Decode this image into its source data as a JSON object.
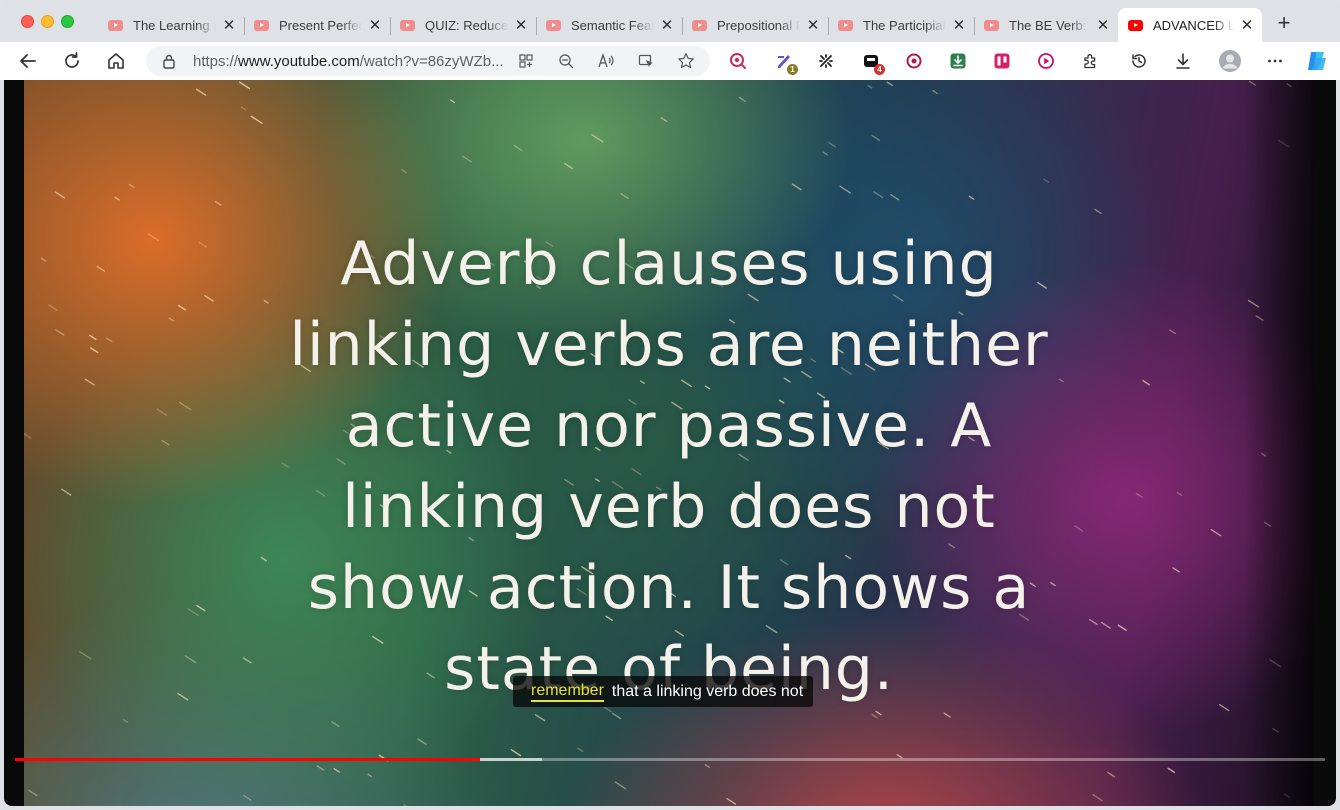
{
  "browser": {
    "tabs": [
      {
        "title": "The Learning English",
        "active": false
      },
      {
        "title": "Present Perfect",
        "active": false
      },
      {
        "title": "QUIZ: Reduced",
        "active": false
      },
      {
        "title": "Semantic Features",
        "active": false
      },
      {
        "title": "Prepositional Phrases",
        "active": false
      },
      {
        "title": "The Participial",
        "active": false
      },
      {
        "title": "The BE Verb: Is",
        "active": false
      },
      {
        "title": "ADVANCED LEVEL",
        "active": true
      }
    ],
    "tab_close_glyph": "✕",
    "new_tab_glyph": "+",
    "address": {
      "scheme": "https://",
      "domain": "www.youtube.com",
      "path": "/watch?v=86zyWZb..."
    },
    "extension_badges": {
      "first": "1",
      "second": "4"
    }
  },
  "video": {
    "slide_lines": [
      "Adverb clauses using",
      "linking verbs are neither",
      "active nor passive. A",
      "linking verb does not",
      "show action. It shows a",
      "state of being."
    ],
    "caption": {
      "highlight_word": "remember",
      "rest": "that a linking verb does not"
    },
    "progress": {
      "played_fraction": 0.355,
      "buffered_fraction": 0.402
    }
  },
  "colors": {
    "progress_played": "#ff0000",
    "caption_highlight": "#e8e13a",
    "active_tab_favicon": "#ff0000"
  }
}
